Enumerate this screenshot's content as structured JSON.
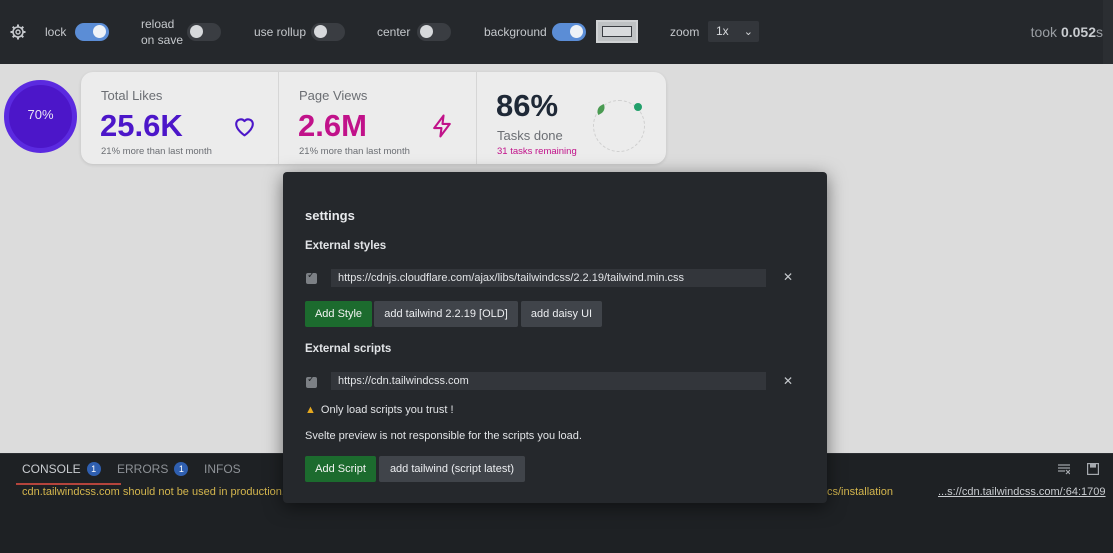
{
  "toolbar": {
    "lock_label": "lock",
    "reload_label_1": "reload",
    "reload_label_2": "on save",
    "rollup_label": "use rollup",
    "center_label": "center",
    "background_label": "background",
    "zoom_label": "zoom",
    "zoom_value": "1x",
    "took_label": "took",
    "took_value": "0.052",
    "took_unit": "s",
    "toggles": {
      "lock": true,
      "reload_on_save": false,
      "use_rollup": false,
      "center": false,
      "background": true
    }
  },
  "preview": {
    "radial_progress_text": "70%",
    "radial_progress_value": 70,
    "stats": [
      {
        "title": "Total Likes",
        "value": "25.6K",
        "desc": "21% more than last month",
        "icon": "heart-icon",
        "color": "#4c16c9"
      },
      {
        "title": "Page Views",
        "value": "2.6M",
        "desc": "21% more than last month",
        "icon": "bolt-icon",
        "color": "#c1128a"
      },
      {
        "title": "Tasks done",
        "value": "86%",
        "desc": "31 tasks remaining",
        "icon": "avatar",
        "color": "#1f2937"
      }
    ]
  },
  "console": {
    "tabs": [
      {
        "label": "CONSOLE",
        "count": "1"
      },
      {
        "label": "ERRORS",
        "count": "1"
      },
      {
        "label": "INFOS"
      }
    ],
    "log_message": "cdn.tailwindcss.com should not be used in production.",
    "log_message_tail": "cs/installation",
    "log_source": "...s://cdn.tailwindcss.com/:64:1709"
  },
  "settings": {
    "title": "settings",
    "external_styles_label": "External styles",
    "style_url": "https://cdnjs.cloudflare.com/ajax/libs/tailwindcss/2.2.19/tailwind.min.css",
    "add_style": "Add Style",
    "add_tailwind_old": "add tailwind 2.2.19 [OLD]",
    "add_daisy": "add daisy UI",
    "external_scripts_label": "External scripts",
    "script_url": "https://cdn.tailwindcss.com",
    "warning": "Only load scripts you trust !",
    "note": "Svelte preview is not responsible for the scripts you load.",
    "add_script": "Add Script",
    "add_tailwind_script": "add tailwind (script latest)",
    "close_glyph": "✕"
  },
  "colors": {
    "accent_blue": "#5b8dd6",
    "green_button": "#1c6b2e",
    "warning_yellow": "#e5a81f"
  }
}
